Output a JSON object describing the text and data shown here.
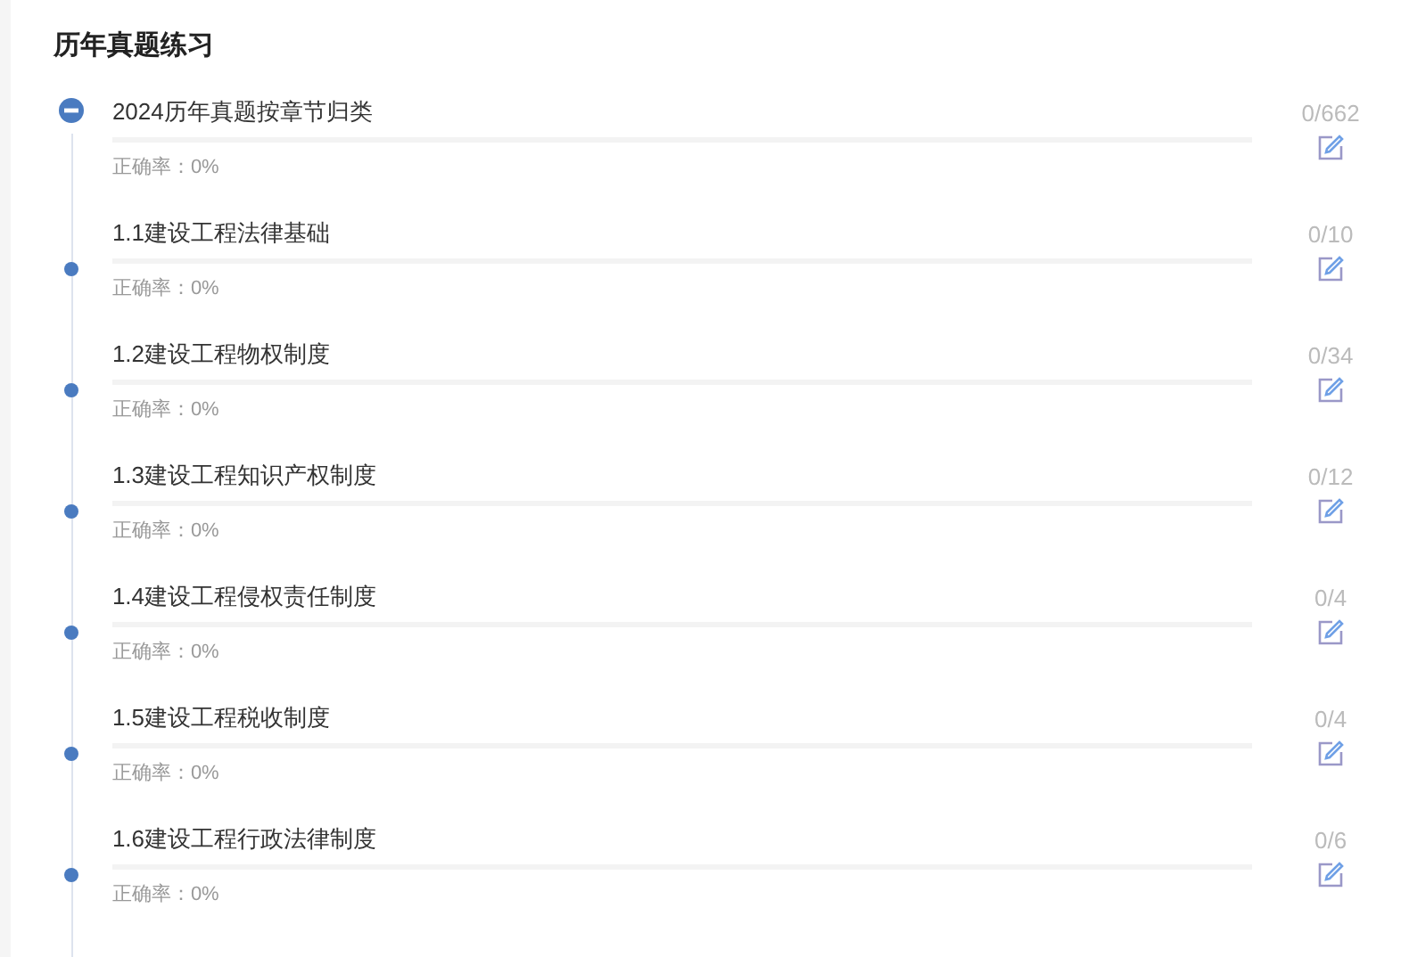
{
  "title": "历年真题练习",
  "items": [
    {
      "kind": "group",
      "expanded": true,
      "name": "2024历年真题按章节归类",
      "accuracy": "正确率：0%",
      "level": 0,
      "count": "0/662"
    },
    {
      "kind": "chapter",
      "name": "1.1建设工程法律基础",
      "accuracy": "正确率：0%",
      "level": 0,
      "count": "0/10"
    },
    {
      "kind": "chapter",
      "name": "1.2建设工程物权制度",
      "accuracy": "正确率：0%",
      "level": 0,
      "count": "0/34"
    },
    {
      "kind": "chapter",
      "name": "1.3建设工程知识产权制度",
      "accuracy": "正确率：0%",
      "level": 0,
      "count": "0/12"
    },
    {
      "kind": "chapter",
      "name": "1.4建设工程侵权责任制度",
      "accuracy": "正确率：0%",
      "level": 0,
      "count": "0/4"
    },
    {
      "kind": "chapter",
      "name": "1.5建设工程税收制度",
      "accuracy": "正确率：0%",
      "level": 0,
      "count": "0/4"
    },
    {
      "kind": "chapter",
      "name": "1.6建设工程行政法律制度",
      "accuracy": "正确率：0%",
      "level": 0,
      "count": "0/6"
    }
  ]
}
